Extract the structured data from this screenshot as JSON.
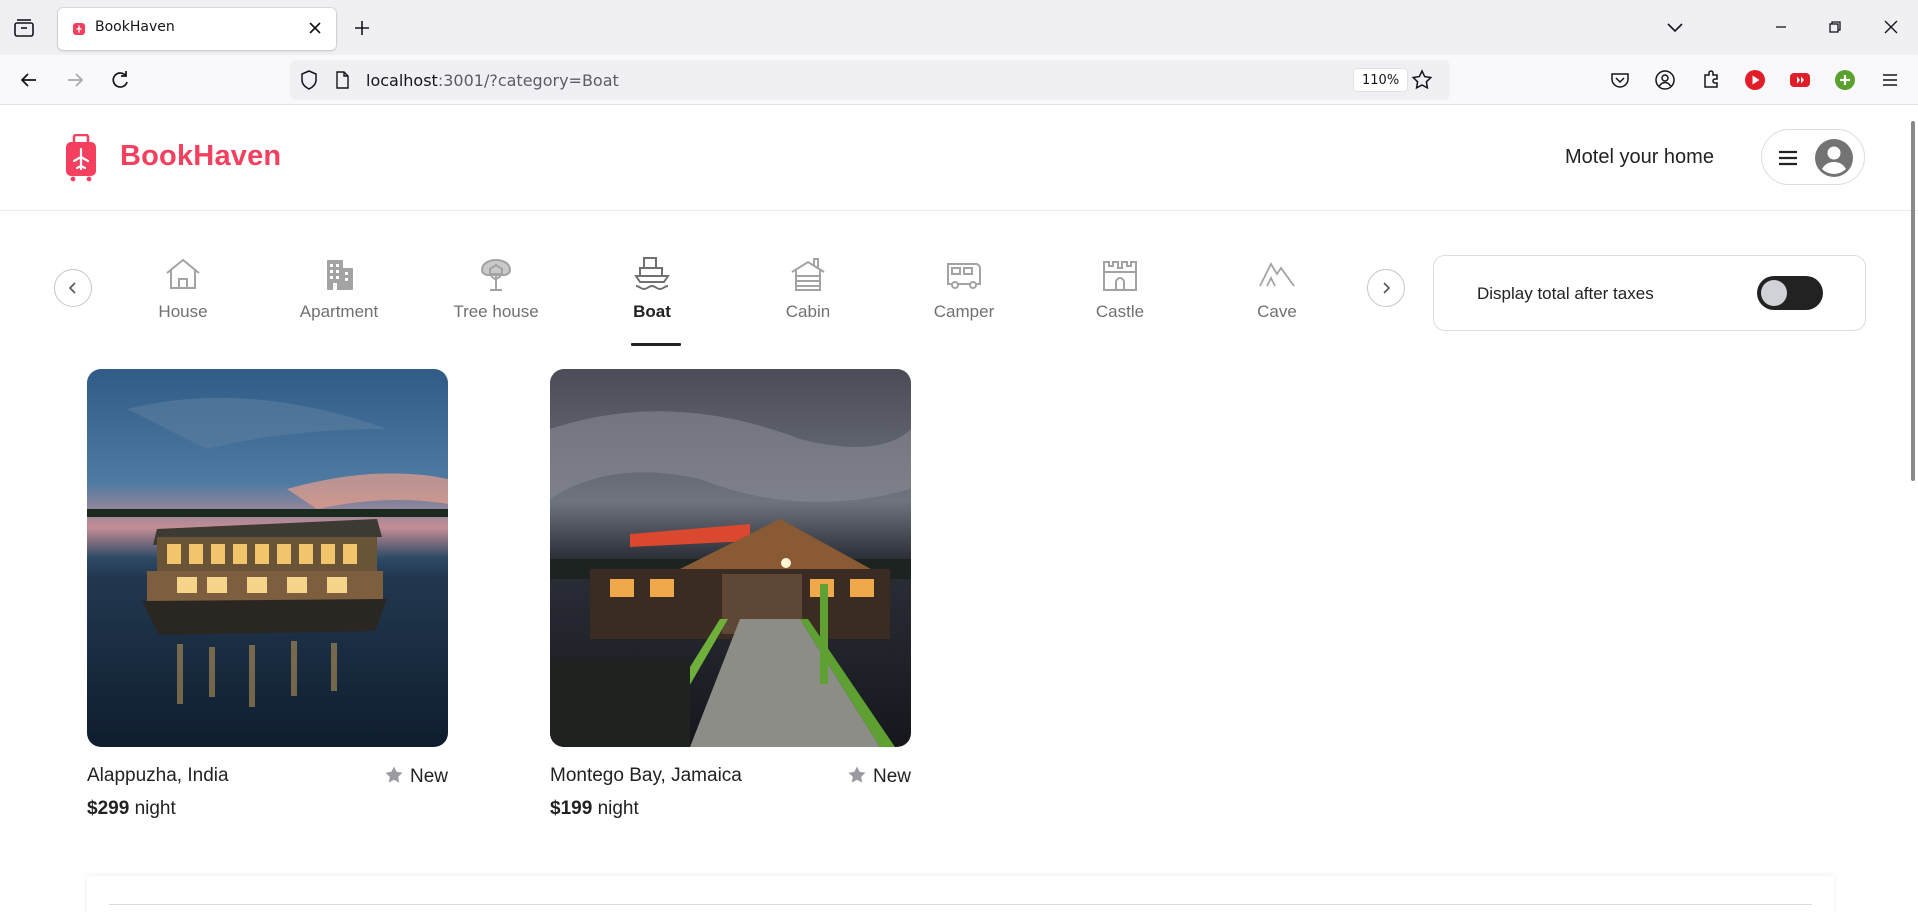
{
  "browser": {
    "tab_title": "BookHaven",
    "url_host": "localhost",
    "url_rest": ":3001/?category=Boat",
    "zoom": "110%",
    "icons": [
      "tab-list-icon",
      "close-icon",
      "plus-icon",
      "chevron-down-icon",
      "minimize-icon",
      "restore-icon",
      "close-window-icon",
      "back-icon",
      "forward-icon",
      "reload-icon",
      "shield-icon",
      "page-icon",
      "star-icon",
      "pocket-icon",
      "account-icon",
      "extensions-icon",
      "menu-icon"
    ]
  },
  "header": {
    "logo_text": "BookHaven",
    "brand_color": "#f43f5e",
    "host_link": "Motel your home"
  },
  "categories": [
    {
      "label": "House",
      "icon": "house-icon",
      "active": false
    },
    {
      "label": "Apartment",
      "icon": "apartment-icon",
      "active": false
    },
    {
      "label": "Tree house",
      "icon": "tree-house-icon",
      "active": false
    },
    {
      "label": "Boat",
      "icon": "boat-icon",
      "active": true
    },
    {
      "label": "Cabin",
      "icon": "cabin-icon",
      "active": false
    },
    {
      "label": "Camper",
      "icon": "camper-icon",
      "active": false
    },
    {
      "label": "Castle",
      "icon": "castle-icon",
      "active": false
    },
    {
      "label": "Cave",
      "icon": "cave-icon",
      "active": false
    }
  ],
  "tax_toggle": {
    "label": "Display total after taxes",
    "checked": false
  },
  "listings": [
    {
      "location": "Alappuzha, India",
      "rating": "New",
      "price": "$299",
      "unit": "night"
    },
    {
      "location": "Montego Bay, Jamaica",
      "rating": "New",
      "price": "$199",
      "unit": "night"
    }
  ]
}
